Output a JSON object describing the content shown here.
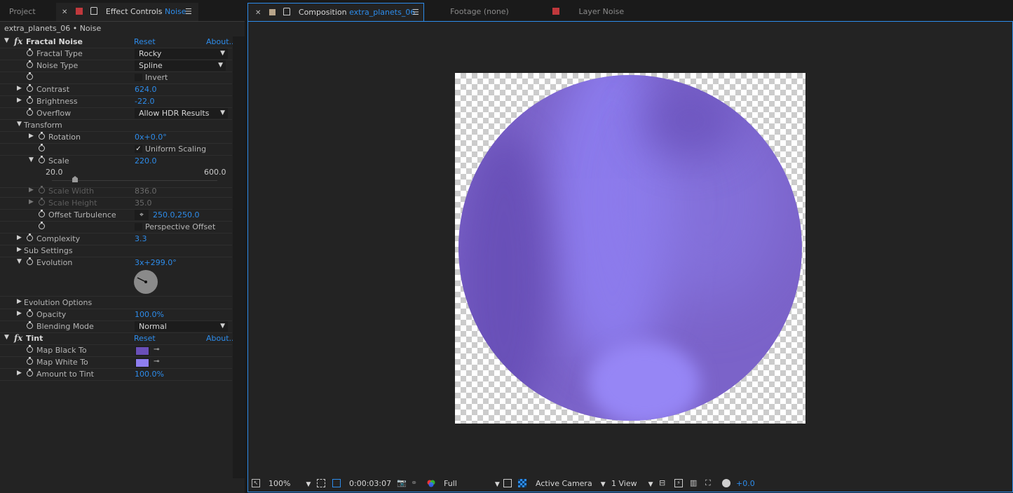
{
  "left_tabs": {
    "project": "Project",
    "effect_controls": "Effect Controls",
    "effect_controls_layer": "Noise"
  },
  "right_tabs": {
    "composition": "Composition",
    "composition_name": "extra_planets_06",
    "footage": "Footage (none)",
    "layer": "Layer Noise"
  },
  "effect_controls": {
    "header": "extra_planets_06 • Noise",
    "fractal_noise": {
      "title": "Fractal Noise",
      "reset": "Reset",
      "about": "About...",
      "fractal_type_label": "Fractal Type",
      "fractal_type_value": "Rocky",
      "noise_type_label": "Noise Type",
      "noise_type_value": "Spline",
      "invert_label": "Invert",
      "contrast_label": "Contrast",
      "contrast_value": "624.0",
      "brightness_label": "Brightness",
      "brightness_value": "-22.0",
      "overflow_label": "Overflow",
      "overflow_value": "Allow HDR Results",
      "transform_label": "Transform",
      "rotation_label": "Rotation",
      "rotation_value": "0x+0.0°",
      "uniform_scaling_label": "Uniform Scaling",
      "scale_label": "Scale",
      "scale_value": "220.0",
      "scale_min": "20.0",
      "scale_max": "600.0",
      "scale_slider_fraction": 0.14,
      "scale_width_label": "Scale Width",
      "scale_width_value": "836.0",
      "scale_height_label": "Scale Height",
      "scale_height_value": "35.0",
      "offset_turbulence_label": "Offset Turbulence",
      "offset_turbulence_value": "250.0,250.0",
      "perspective_offset_label": "Perspective Offset",
      "complexity_label": "Complexity",
      "complexity_value": "3.3",
      "sub_settings_label": "Sub Settings",
      "evolution_label": "Evolution",
      "evolution_value": "3x+299.0°",
      "evolution_options_label": "Evolution Options",
      "opacity_label": "Opacity",
      "opacity_value": "100.0%",
      "blending_mode_label": "Blending Mode",
      "blending_mode_value": "Normal"
    },
    "tint": {
      "title": "Tint",
      "reset": "Reset",
      "about": "About...",
      "map_black_label": "Map Black To",
      "map_black_color": "#6a4fb8",
      "map_white_label": "Map White To",
      "map_white_color": "#8e7ef0",
      "amount_label": "Amount to Tint",
      "amount_value": "100.0%"
    }
  },
  "viewer_bar": {
    "zoom": "100%",
    "timecode": "0:00:03:07",
    "resolution": "Full",
    "camera": "Active Camera",
    "views": "1 View",
    "exposure": "+0.0"
  },
  "colors": {
    "accent": "#2d8ceb",
    "planet_dark": "#6a4fb8",
    "planet_light": "#8e7ef0"
  }
}
